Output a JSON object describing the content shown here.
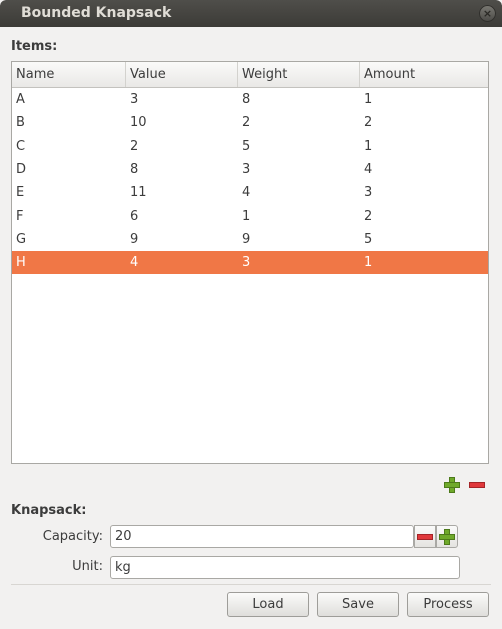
{
  "window": {
    "title": "Bounded Knapsack",
    "close_glyph": "×"
  },
  "items_section": {
    "label": "Items:",
    "columns": [
      "Name",
      "Value",
      "Weight",
      "Amount"
    ],
    "rows": [
      [
        "A",
        "3",
        "8",
        "1"
      ],
      [
        "B",
        "10",
        "2",
        "2"
      ],
      [
        "C",
        "2",
        "5",
        "1"
      ],
      [
        "D",
        "8",
        "3",
        "4"
      ],
      [
        "E",
        "11",
        "4",
        "3"
      ],
      [
        "F",
        "6",
        "1",
        "2"
      ],
      [
        "G",
        "9",
        "9",
        "5"
      ],
      [
        "H",
        "4",
        "3",
        "1"
      ]
    ],
    "selected_row": 7,
    "add_icon": "plus-icon",
    "remove_icon": "minus-icon"
  },
  "knapsack_section": {
    "label": "Knapsack:",
    "capacity_label": "Capacity:",
    "capacity_value": "20",
    "unit_label": "Unit:",
    "unit_value": "kg"
  },
  "buttons": {
    "load": "Load",
    "save": "Save",
    "process": "Process"
  },
  "colors": {
    "selection": "#f07746",
    "add": "#6fa92a",
    "remove": "#e0383b"
  }
}
